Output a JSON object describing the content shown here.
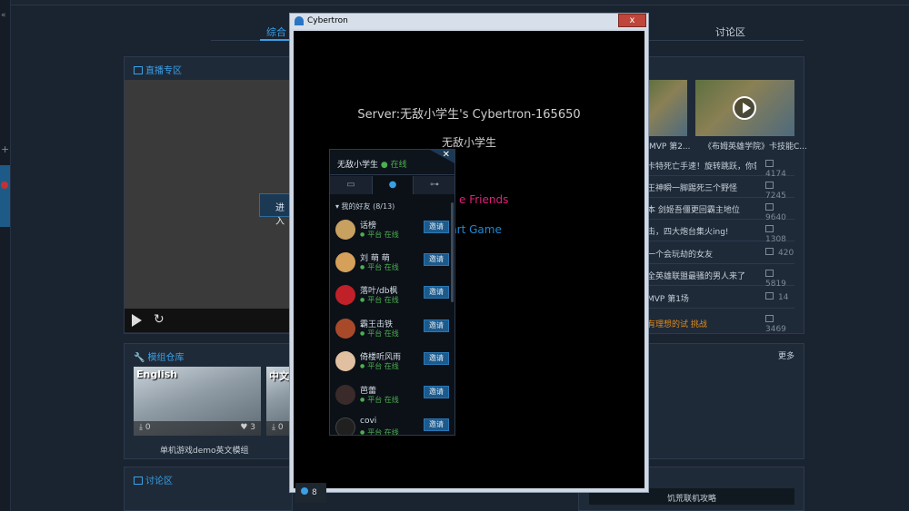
{
  "top_tabs": {
    "overview": "综合",
    "discussion": "讨论区"
  },
  "live": {
    "title": "直播专区",
    "enter_button": "进入"
  },
  "mods": {
    "title": "模组仓库",
    "items": [
      {
        "label": "English",
        "downloads": "0",
        "likes": "3",
        "name": "单机游戏demo英文模组"
      },
      {
        "label": "中文",
        "downloads": "0"
      }
    ]
  },
  "forum": {
    "title": "讨论区"
  },
  "right": {
    "videos": [
      {
        "caption": "MVP 第2..."
      },
      {
        "caption": "《布姆英雄学院》卡技能C..."
      }
    ],
    "rows": [
      {
        "title": "卡特死亡手速！旋转跳跃，你就...",
        "count": "4174"
      },
      {
        "title": "王神瞬一脚踢死三个野怪",
        "count": "7245"
      },
      {
        "title": "本 剑姬吾僵更回霸主地位",
        "count": "9640"
      },
      {
        "title": "击，四大炮台集火ing!",
        "count": "1308"
      },
      {
        "title": "一个会玩劫的女友",
        "count": "420"
      },
      {
        "title": "全英雄联盟最骚的男人来了",
        "count": "5819"
      },
      {
        "title": "MVP 第1场",
        "count": "14"
      },
      {
        "title": "",
        "count": "3469"
      }
    ],
    "orange_text": "有理想的试 挑战",
    "more": "更多",
    "strategy": "饥荒联机攻略"
  },
  "game_window": {
    "title": "Cybertron",
    "close_glyph": "x",
    "server": "Server:无敌小学生's Cybertron-165650",
    "player": "无敌小学生",
    "invite_friends": "e Friends",
    "start_game": "Start Game",
    "online_count": "8"
  },
  "friends_panel": {
    "user_name": "无敌小学生",
    "user_status": "● 在线",
    "close_glyph": "✕",
    "group_label": "▾ 我的好友 (8/13)",
    "friends": [
      {
        "name": "话榜",
        "status": "平台 在线",
        "invite": "邀请",
        "color": "#c8a060"
      },
      {
        "name": "刘 萌 萌",
        "status": "平台 在线",
        "invite": "邀请",
        "color": "#d4a05a"
      },
      {
        "name": "落叶/db枫",
        "status": "平台 在线",
        "invite": "邀请",
        "color": "#c02028"
      },
      {
        "name": "霸王击铁",
        "status": "平台 在线",
        "invite": "邀请",
        "color": "#a84a2a"
      },
      {
        "name": "倚楼听风雨",
        "status": "平台 在线",
        "invite": "邀请",
        "color": "#e0c0a0"
      },
      {
        "name": "芭蕾",
        "status": "平台 在线",
        "invite": "邀请",
        "color": "#3a2a2a"
      },
      {
        "name": "covi",
        "status": "平台 在线",
        "invite": "邀请",
        "color": "#202020"
      }
    ]
  }
}
